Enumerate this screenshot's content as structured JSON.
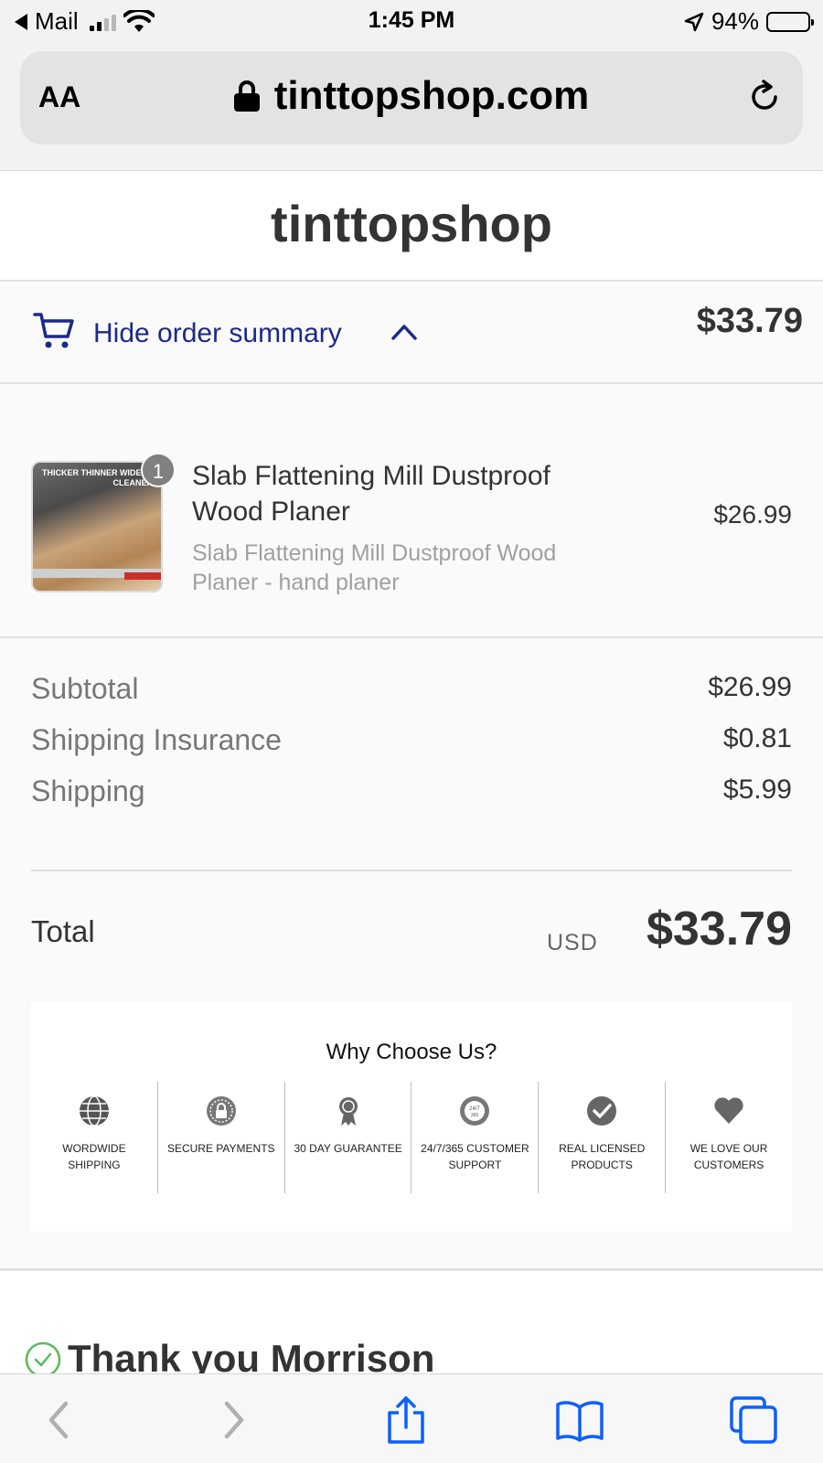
{
  "status_bar": {
    "back_app": "Mail",
    "time": "1:45 PM",
    "battery": "94%"
  },
  "browser": {
    "text_size_label": "AA",
    "url": "tinttopshop.com"
  },
  "store": {
    "name": "tinttopshop"
  },
  "order_summary": {
    "toggle_label": "Hide order summary",
    "header_total": "$33.79",
    "item": {
      "quantity": "1",
      "name": "Slab Flattening Mill Dustproof Wood Planer",
      "variant": "Slab Flattening Mill Dustproof Wood Planer - hand planer",
      "price": "$26.99",
      "thumbnail_text": "THICKER THINNER WIDER & CLEANER!"
    },
    "costs": [
      {
        "label": "Subtotal",
        "value": "$26.99"
      },
      {
        "label": "Shipping Insurance",
        "value": "$0.81"
      },
      {
        "label": "Shipping",
        "value": "$5.99"
      }
    ],
    "total": {
      "label": "Total",
      "currency": "USD",
      "value": "$33.79"
    }
  },
  "why_choose_us": {
    "title": "Why Choose Us?",
    "features": [
      {
        "label": "WORDWIDE SHIPPING",
        "icon": "globe-icon"
      },
      {
        "label": "SECURE PAYMENTS",
        "icon": "secure-lock-icon"
      },
      {
        "label": "30 DAY GUARANTEE",
        "icon": "award-ribbon-icon"
      },
      {
        "label": "24/7/365 CUSTOMER SUPPORT",
        "icon": "support-clock-icon"
      },
      {
        "label": "REAL LICENSED PRODUCTS",
        "icon": "check-badge-icon"
      },
      {
        "label": "WE LOVE OUR CUSTOMERS",
        "icon": "heart-icon"
      }
    ]
  },
  "thank_you": {
    "text": "Thank you Morrison"
  },
  "colors": {
    "link_blue": "#1b2a8a",
    "safari_blue": "#0a60ff",
    "success_green": "#5cb85c"
  }
}
